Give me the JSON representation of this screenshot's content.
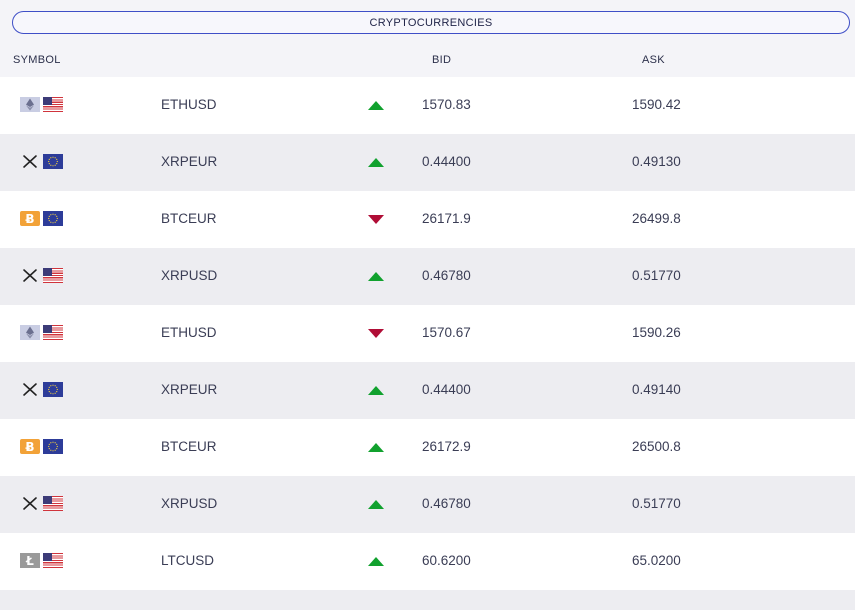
{
  "tab": {
    "label": "CRYPTOCURRENCIES"
  },
  "columns": {
    "symbol": "SYMBOL",
    "bid": "BID",
    "ask": "ASK"
  },
  "colors": {
    "up": "#11a12e",
    "down": "#b00d36",
    "accent": "#3f4fc7"
  },
  "rows": [
    {
      "symbol": "ETHUSD",
      "bid": "1570.83",
      "ask": "1590.42",
      "trend": "up",
      "coin_icon": "ethereum-icon",
      "currency_icon": "us-flag-icon"
    },
    {
      "symbol": "XRPEUR",
      "bid": "0.44400",
      "ask": "0.49130",
      "trend": "up",
      "coin_icon": "xrp-icon",
      "currency_icon": "eu-flag-icon"
    },
    {
      "symbol": "BTCEUR",
      "bid": "26171.9",
      "ask": "26499.8",
      "trend": "down",
      "coin_icon": "bitcoin-icon",
      "currency_icon": "eu-flag-icon"
    },
    {
      "symbol": "XRPUSD",
      "bid": "0.46780",
      "ask": "0.51770",
      "trend": "up",
      "coin_icon": "xrp-icon",
      "currency_icon": "us-flag-icon"
    },
    {
      "symbol": "ETHUSD",
      "bid": "1570.67",
      "ask": "1590.26",
      "trend": "down",
      "coin_icon": "ethereum-icon",
      "currency_icon": "us-flag-icon"
    },
    {
      "symbol": "XRPEUR",
      "bid": "0.44400",
      "ask": "0.49140",
      "trend": "up",
      "coin_icon": "xrp-icon",
      "currency_icon": "eu-flag-icon"
    },
    {
      "symbol": "BTCEUR",
      "bid": "26172.9",
      "ask": "26500.8",
      "trend": "up",
      "coin_icon": "bitcoin-icon",
      "currency_icon": "eu-flag-icon"
    },
    {
      "symbol": "XRPUSD",
      "bid": "0.46780",
      "ask": "0.51770",
      "trend": "up",
      "coin_icon": "xrp-icon",
      "currency_icon": "us-flag-icon"
    },
    {
      "symbol": "LTCUSD",
      "bid": "60.6200",
      "ask": "65.0200",
      "trend": "up",
      "coin_icon": "litecoin-icon",
      "currency_icon": "us-flag-icon"
    }
  ]
}
